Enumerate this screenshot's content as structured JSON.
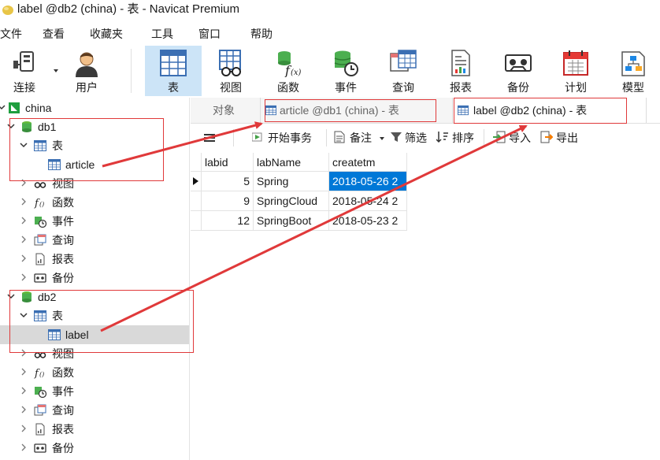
{
  "window": {
    "title": "label @db2 (china) - 表 - Navicat Premium"
  },
  "menu": [
    "文件",
    "查看",
    "收藏夹",
    "工具",
    "窗口",
    "帮助"
  ],
  "toolbar": {
    "connect": "连接",
    "user": "用户",
    "items": [
      "表",
      "视图",
      "函数",
      "事件",
      "查询",
      "报表",
      "备份",
      "计划",
      "模型"
    ],
    "active": "表"
  },
  "tree": {
    "connection": "china",
    "databases": [
      {
        "name": "db1",
        "tables_label": "表",
        "table": "article",
        "views": "视图",
        "functions": "函数",
        "events": "事件",
        "queries": "查询",
        "reports": "报表",
        "backups": "备份"
      },
      {
        "name": "db2",
        "tables_label": "表",
        "table": "label",
        "views": "视图",
        "functions": "函数",
        "events": "事件",
        "queries": "查询",
        "reports": "报表",
        "backups": "备份"
      }
    ]
  },
  "tabs": [
    "对象",
    "article @db1 (china) - 表",
    "label @db2 (china) - 表"
  ],
  "object_toolbar": {
    "begin_transaction": "开始事务",
    "note": "备注",
    "filter": "筛选",
    "sort": "排序",
    "import": "导入",
    "export": "导出"
  },
  "grid": {
    "columns": [
      "labid",
      "labName",
      "createtm"
    ],
    "rows": [
      [
        "5",
        "Spring",
        "2018-05-26 2"
      ],
      [
        "9",
        "SpringCloud",
        "2018-05-24 2"
      ],
      [
        "12",
        "SpringBoot",
        "2018-05-23 2"
      ]
    ]
  },
  "colors": {
    "accent": "#0078d7",
    "annotation": "#e0393a",
    "active_tool": "#cce4f7"
  }
}
